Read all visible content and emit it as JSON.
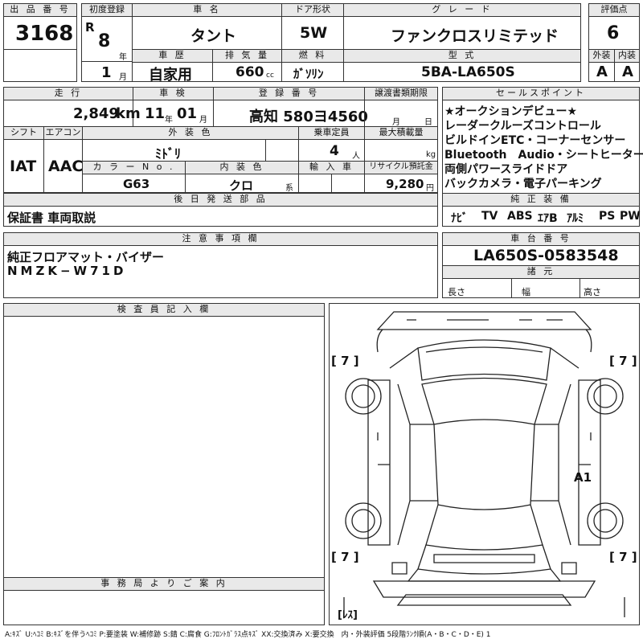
{
  "lot": {
    "label": "出 品 番 号",
    "value": "3168"
  },
  "first_reg": {
    "label": "初度登録",
    "era": "R",
    "year": "8",
    "year_unit": "年",
    "month": "1",
    "month_unit": "月"
  },
  "car_name": {
    "label": "車 名",
    "value": "タント"
  },
  "door": {
    "label": "ドア形状",
    "value": "5W"
  },
  "grade": {
    "label": "グ レ ー ド",
    "value": "ファンクロスリミテッド"
  },
  "rating": {
    "label": "評価点",
    "value": "6",
    "ext_label": "外装",
    "int_label": "内装",
    "ext": "A",
    "int": "A"
  },
  "history": {
    "label": "車 歴",
    "value": "自家用"
  },
  "displacement": {
    "label": "排 気 量",
    "value": "660",
    "unit": "cc"
  },
  "fuel": {
    "label": "燃 料",
    "value": "ｶﾞｿﾘﾝ"
  },
  "model_code": {
    "label": "型 式",
    "value": "5BA-LA650S"
  },
  "mileage": {
    "label": "走 行",
    "value": "2,849",
    "unit": "km"
  },
  "inspection": {
    "label": "車 検",
    "year": "11",
    "year_unit": "年",
    "month": "01",
    "month_unit": "月"
  },
  "registration": {
    "label": "登 録 番 号",
    "value": "高知 580ヨ4560"
  },
  "transfer_deadline": {
    "label": "譲渡書類期限",
    "month_unit": "月",
    "day_unit": "日"
  },
  "shift": {
    "label": "シフト",
    "value": "IAT"
  },
  "aircon": {
    "label": "エアコン",
    "value": "AAC"
  },
  "exterior_color": {
    "label": "外 装 色",
    "value": "ﾐﾄﾞﾘ"
  },
  "capacity": {
    "label": "乗車定員",
    "value": "4",
    "unit": "人"
  },
  "max_load": {
    "label": "最大積載量",
    "unit": "kg"
  },
  "color_no": {
    "label": "カ ラ ー N o .",
    "value": "G63"
  },
  "interior_color": {
    "label": "内 装 色",
    "value": "クロ",
    "suffix": "系"
  },
  "import": {
    "label": "輸 入 車"
  },
  "recycle": {
    "label": "リサイクル預託金",
    "value": "9,280",
    "unit": "円"
  },
  "sales_points": {
    "label": "セールスポイント",
    "items": [
      "★オークションデビュー★",
      "レーダークルーズコントロール",
      "ビルドインETC・コーナーセンサー",
      "Bluetooth　Audio・シートヒーター",
      "両側パワースライドドア",
      "バックカメラ・電子パーキング"
    ]
  },
  "later_parts": {
    "label": "後 日 発 送 部 品",
    "value": "保証書 車両取説"
  },
  "equipment": {
    "label": "純 正 装 備",
    "items": [
      "ﾅﾋﾞ",
      "TV",
      "ABS",
      "ｴｱB",
      "ｱﾙﾐ",
      "PS",
      "PW"
    ]
  },
  "notes": {
    "label": "注 意 事 項 欄",
    "lines": [
      "純正フロアマット・バイザー",
      "NMZK−W71D"
    ]
  },
  "chassis": {
    "label": "車 台 番 号",
    "value": "LA650S-0583548"
  },
  "specs": {
    "label": "諸 元",
    "length": "長さ",
    "width": "幅",
    "height": "高さ"
  },
  "inspector": {
    "label": "検 査 員 記 入 欄"
  },
  "office": {
    "label": "事 務 局 よ り ご 案 内"
  },
  "diagram": {
    "marks": [
      "[ 7 ]",
      "[ 7 ]",
      "[ 7 ]",
      "[ 7 ]"
    ],
    "damage": "A1",
    "lower": "[ﾚｽ]"
  },
  "legend": "A:ｷｽﾞ U:ﾍｺﾐ B:ｷｽﾞを伴うﾍｺﾐ P:要塗装 W:補修跡 S:錆 C:腐食 G:ﾌﾛﾝﾄｶﾞﾗｽ点ｷｽﾞ XX:交換済み X:要交換　内・外装評価 5段階ﾗﾝｸ順(A・B・C・D・E) 1"
}
